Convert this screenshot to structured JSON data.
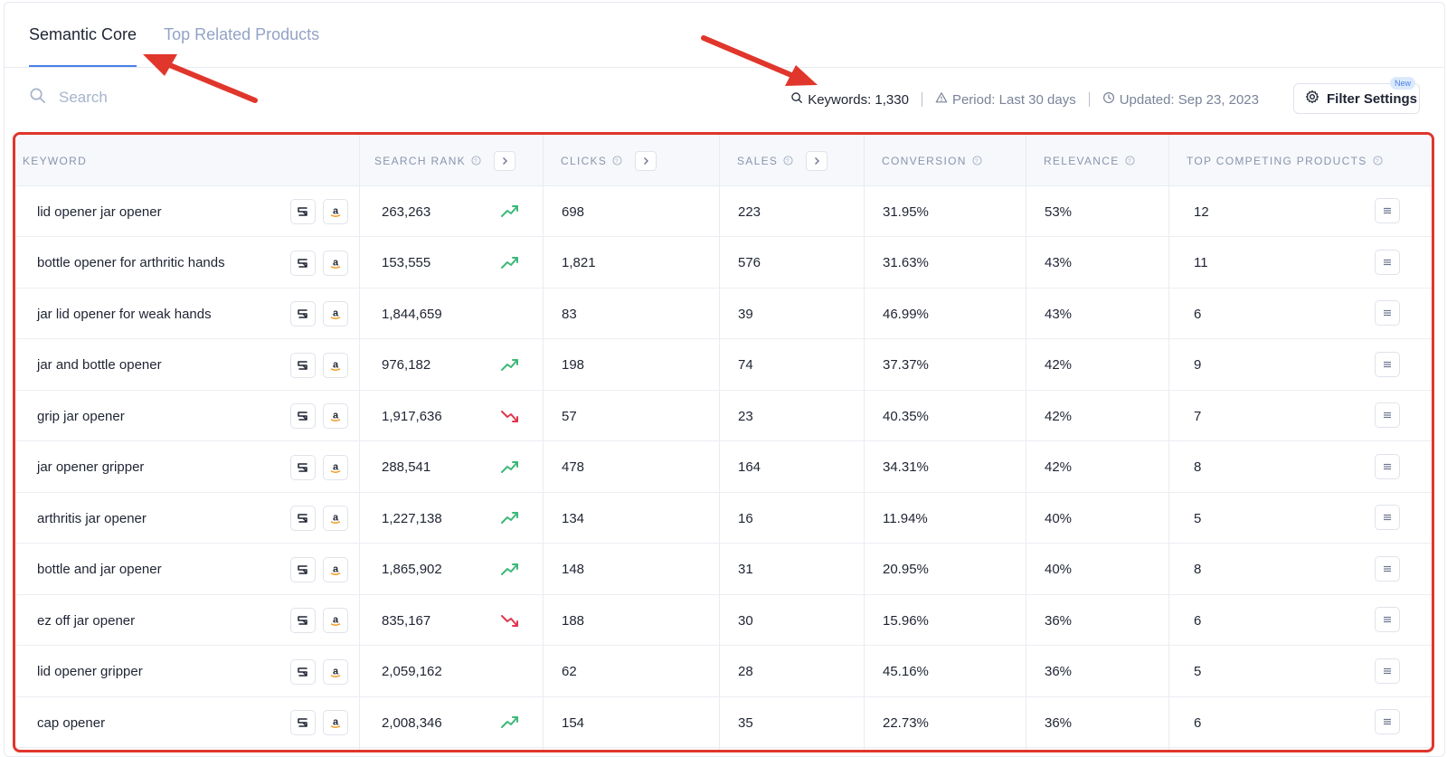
{
  "tabs": [
    {
      "label": "Semantic Core",
      "active": true
    },
    {
      "label": "Top Related Products",
      "active": false
    }
  ],
  "search": {
    "placeholder": "Search",
    "value": ""
  },
  "stats": {
    "keywords": "Keywords: 1,330",
    "period": "Period: Last 30 days",
    "updated": "Updated: Sep 23, 2023"
  },
  "filter": {
    "label": "Filter Settings",
    "badge": "New"
  },
  "columns": {
    "keyword": "KEYWORD",
    "search_rank": "SEARCH RANK",
    "clicks": "CLICKS",
    "sales": "SALES",
    "conversion": "CONVERSION",
    "relevance": "RELEVANCE",
    "top_competing": "TOP COMPETING PRODUCTS"
  },
  "rows": [
    {
      "keyword": "lid opener jar opener",
      "search_rank": "263,263",
      "trend": "up",
      "clicks": "698",
      "sales": "223",
      "conversion": "31.95%",
      "relevance": "53%",
      "competing": "12"
    },
    {
      "keyword": "bottle opener for arthritic hands",
      "search_rank": "153,555",
      "trend": "up",
      "clicks": "1,821",
      "sales": "576",
      "conversion": "31.63%",
      "relevance": "43%",
      "competing": "11"
    },
    {
      "keyword": "jar lid opener for weak hands",
      "search_rank": "1,844,659",
      "trend": "none",
      "clicks": "83",
      "sales": "39",
      "conversion": "46.99%",
      "relevance": "43%",
      "competing": "6"
    },
    {
      "keyword": "jar and bottle opener",
      "search_rank": "976,182",
      "trend": "up",
      "clicks": "198",
      "sales": "74",
      "conversion": "37.37%",
      "relevance": "42%",
      "competing": "9"
    },
    {
      "keyword": "grip jar opener",
      "search_rank": "1,917,636",
      "trend": "down",
      "clicks": "57",
      "sales": "23",
      "conversion": "40.35%",
      "relevance": "42%",
      "competing": "7"
    },
    {
      "keyword": "jar opener gripper",
      "search_rank": "288,541",
      "trend": "up",
      "clicks": "478",
      "sales": "164",
      "conversion": "34.31%",
      "relevance": "42%",
      "competing": "8"
    },
    {
      "keyword": "arthritis jar opener",
      "search_rank": "1,227,138",
      "trend": "up",
      "clicks": "134",
      "sales": "16",
      "conversion": "11.94%",
      "relevance": "40%",
      "competing": "5"
    },
    {
      "keyword": "bottle and jar opener",
      "search_rank": "1,865,902",
      "trend": "up",
      "clicks": "148",
      "sales": "31",
      "conversion": "20.95%",
      "relevance": "40%",
      "competing": "8"
    },
    {
      "keyword": "ez off jar opener",
      "search_rank": "835,167",
      "trend": "down",
      "clicks": "188",
      "sales": "30",
      "conversion": "15.96%",
      "relevance": "36%",
      "competing": "6"
    },
    {
      "keyword": "lid opener gripper",
      "search_rank": "2,059,162",
      "trend": "none",
      "clicks": "62",
      "sales": "28",
      "conversion": "45.16%",
      "relevance": "36%",
      "competing": "5"
    },
    {
      "keyword": "cap opener",
      "search_rank": "2,008,346",
      "trend": "up",
      "clicks": "154",
      "sales": "35",
      "conversion": "22.73%",
      "relevance": "36%",
      "competing": "6"
    }
  ],
  "icons": {
    "search": "search-icon",
    "keywords": "magnifier-icon",
    "period": "warning-triangle-icon",
    "updated": "clock-icon",
    "filter": "gear-icon",
    "rank_tool": "sr-logo-icon",
    "amazon": "amazon-icon",
    "trend_up": "trend-up-icon",
    "trend_down": "trend-down-icon",
    "row_menu": "menu-icon"
  },
  "colors": {
    "accent": "#4a80ea",
    "annotation": "#e0362b",
    "trend_up": "#3cb878",
    "trend_down": "#e0364d",
    "muted": "#93a3c6"
  }
}
